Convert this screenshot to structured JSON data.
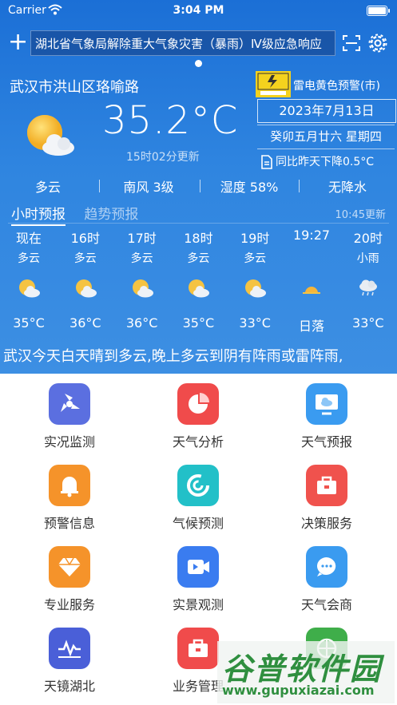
{
  "status_bar": {
    "carrier": "Carrier",
    "time": "3:04 PM"
  },
  "ticker": {
    "text": "湖北省气象局解除重大气象灾害（暴雨）Ⅳ级应急响应"
  },
  "location": "武汉市洪山区珞喻路",
  "current": {
    "temperature": "35.2°C",
    "update_time": "15时02分更新",
    "icon": "cloudy-sun-icon"
  },
  "alert": {
    "text": "雷电黄色预警(市)",
    "icon": "thunder-warning-icon"
  },
  "date": {
    "solar": "2023年7月13日",
    "lunar": "癸卯五月廿六 星期四",
    "compare": "同比昨天下降0.5°C"
  },
  "summary": {
    "condition": "多云",
    "wind": "南风 3级",
    "humidity": "湿度 58%",
    "rain": "无降水"
  },
  "tabs": {
    "hourly": "小时预报",
    "trend": "趋势预报",
    "update": "10:45更新"
  },
  "hourly": [
    {
      "time": "现在",
      "desc": "多云",
      "icon": "partly-cloudy-icon",
      "value": "35°C"
    },
    {
      "time": "16时",
      "desc": "多云",
      "icon": "partly-cloudy-icon",
      "value": "36°C"
    },
    {
      "time": "17时",
      "desc": "多云",
      "icon": "partly-cloudy-icon",
      "value": "36°C"
    },
    {
      "time": "18时",
      "desc": "多云",
      "icon": "partly-cloudy-icon",
      "value": "35°C"
    },
    {
      "time": "19时",
      "desc": "多云",
      "icon": "partly-cloudy-icon",
      "value": "33°C"
    },
    {
      "time": "19:27",
      "desc": "",
      "icon": "sunset-icon",
      "value": "日落"
    },
    {
      "time": "20时",
      "desc": "小雨",
      "icon": "light-rain-icon",
      "value": "33°C"
    }
  ],
  "scroll_text": "武汉今天白天晴到多云,晚上多云到阴有阵雨或雷阵雨,",
  "menu": [
    {
      "label": "实况监测",
      "icon": "monitor-fan-icon",
      "color": "#5b6fe0"
    },
    {
      "label": "天气分析",
      "icon": "pie-chart-icon",
      "color": "#f04b4b"
    },
    {
      "label": "天气预报",
      "icon": "forecast-screen-icon",
      "color": "#3a9bf0"
    },
    {
      "label": "预警信息",
      "icon": "bell-icon",
      "color": "#f5932a"
    },
    {
      "label": "气候预测",
      "icon": "climate-c-icon",
      "color": "#22c0c8"
    },
    {
      "label": "决策服务",
      "icon": "briefcase-icon",
      "color": "#f0524d"
    },
    {
      "label": "专业服务",
      "icon": "diamond-icon",
      "color": "#f5932a"
    },
    {
      "label": "实景观测",
      "icon": "video-icon",
      "color": "#3a7cf0"
    },
    {
      "label": "天气会商",
      "icon": "chat-icon",
      "color": "#3a9bf0"
    },
    {
      "label": "天镜湖北",
      "icon": "wave-icon",
      "color": "#4a5fd8"
    },
    {
      "label": "业务管理",
      "icon": "toolbox-icon",
      "color": "#f04b4b"
    },
    {
      "label": "",
      "icon": "globe-icon",
      "color": "#3fae4a"
    }
  ],
  "watermark": {
    "title": "谷普软件园",
    "url": "www.gupuxiazai.com"
  }
}
